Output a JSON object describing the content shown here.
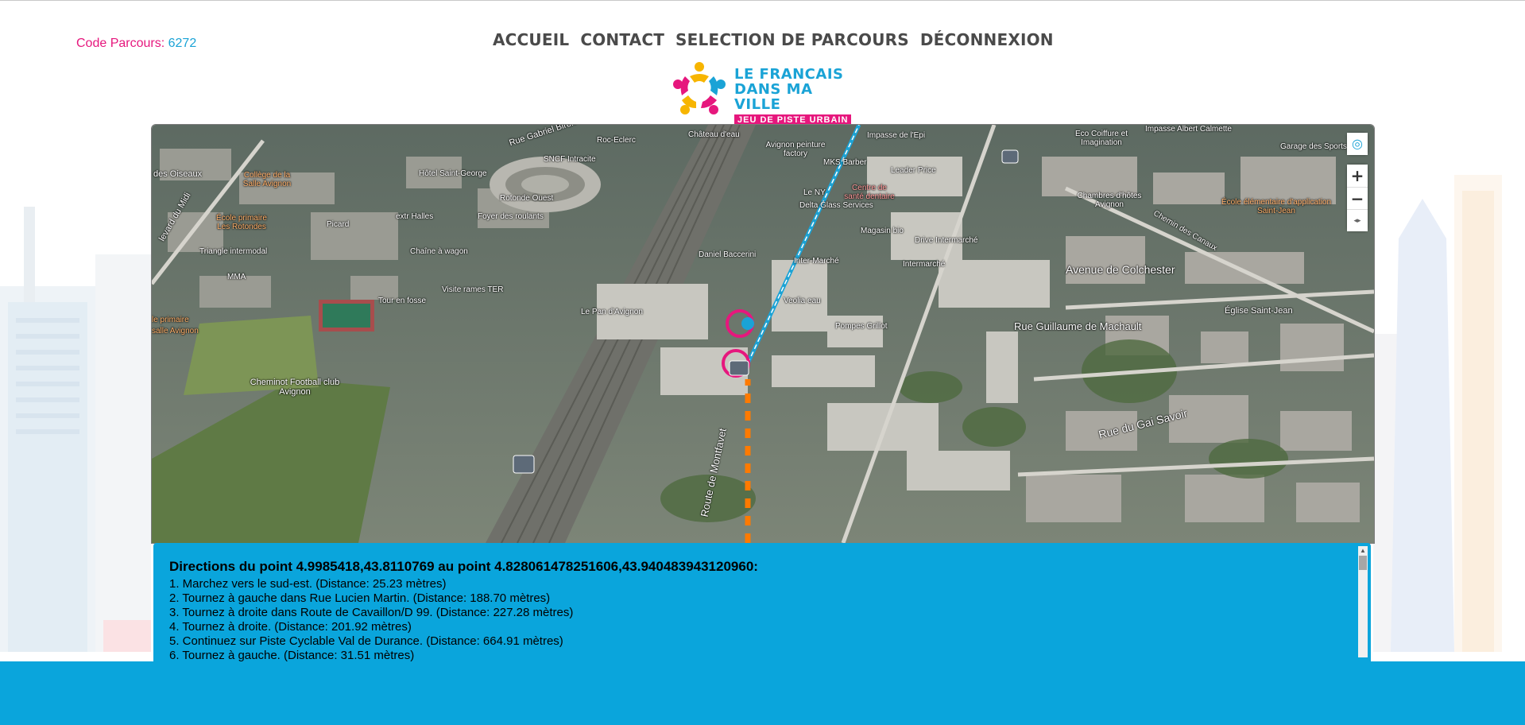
{
  "code_parcours": {
    "label": "Code Parcours:",
    "value": "6272"
  },
  "nav": [
    "ACCUEIL",
    "CONTACT",
    "SELECTION DE PARCOURS",
    "DÉCONNEXION"
  ],
  "logo": {
    "line1": "LE FRANCAIS",
    "line2": "DANS MA VILLE",
    "tagline": "JEU DE PISTE URBAIN"
  },
  "map": {
    "labels": {
      "rue_gabriel_biron": "Rue Gabriel Biron",
      "sncf": "SNCF Intracite",
      "roc_eclerc": "Roc-Eclerc",
      "chateau": "Château d'eau",
      "avignon_peinture": "Avignon peinture factory",
      "mks": "MKS Barber",
      "impasse_epi": "Impasse de l'Epi",
      "impasse_calmette": "Impasse Albert Calmette",
      "eco_coiffure": "Eco Coiffure et Imagination",
      "garage": "Garage des Sports",
      "hotel_st_george": "Hôtel Saint-George",
      "rotonde": "Rotonde Ouest",
      "foyer": "Foyer des roulants",
      "college": "Collège de la Salle Avignon",
      "oiseaux": "des Oiseaux",
      "ecole_rotondes": "École primaire Les Rotondes",
      "extra_halles": "extr Halles",
      "picard": "Picard",
      "boulevard_midi": "levard du Midi",
      "triangle": "Triangle intermodal",
      "chaine": "Chaîne à wagon",
      "mma": "MMA",
      "visite_ter": "Visite rames TER",
      "tour_fosse": "Tour en fosse",
      "ecole_primaire_left": "le primaire",
      "salle_avignon": "salle Avignon",
      "cheminot": "Cheminot Football club Avignon",
      "leader_price": "Leader Price",
      "centre_sante": "Centre de santé dentaire",
      "le_ny": "Le NY",
      "delta": "Delta Glass Services",
      "magasin_bio": "Magasin bio",
      "drive": "Drive Intermarché",
      "intermarche": "Intermarché",
      "inter_marche": "Inter-Marché",
      "daniel": "Daniel Baccerini",
      "chambres": "Chambres d'hôtes Avignon",
      "chemin_canaux": "Chemin des Canaux",
      "ecole_elementaire": "École élémentaire d'application Saint-Jean",
      "colchester": "Avenue de Colchester",
      "eglise": "Église Saint-Jean",
      "machault": "Rue Guillaume de Machault",
      "pan_avignon": "Le Pan d'Avignon",
      "veolia": "Veolia eau",
      "pompes": "Pompes Grillot",
      "montfavet": "Route de Montfavet",
      "gai_savoir": "Rue du Gai Savoir"
    },
    "controls": {
      "locate": "◎",
      "zoom_in": "+",
      "zoom_out": "−",
      "compass": "◂▸"
    }
  },
  "directions": {
    "title": "Directions du point 4.9985418,43.8110769 au point 4.828061478251606,43.940483943120960:",
    "steps": [
      "1. Marchez vers le sud-est. (Distance: 25.23 mètres)",
      "2. Tournez à gauche dans Rue Lucien Martin. (Distance: 188.70 mètres)",
      "3. Tournez à droite dans Route de Cavaillon/D 99. (Distance: 227.28 mètres)",
      "4. Tournez à droite. (Distance: 201.92 mètres)",
      "5. Continuez sur Piste Cyclable Val de Durance. (Distance: 664.91 mètres)",
      "6. Tournez à gauche. (Distance: 31.51 mètres)"
    ]
  },
  "colors": {
    "pink": "#e6177d",
    "blue": "#0aa5dc",
    "route_blue": "#1aa3d6",
    "route_orange": "#ff7a00"
  }
}
